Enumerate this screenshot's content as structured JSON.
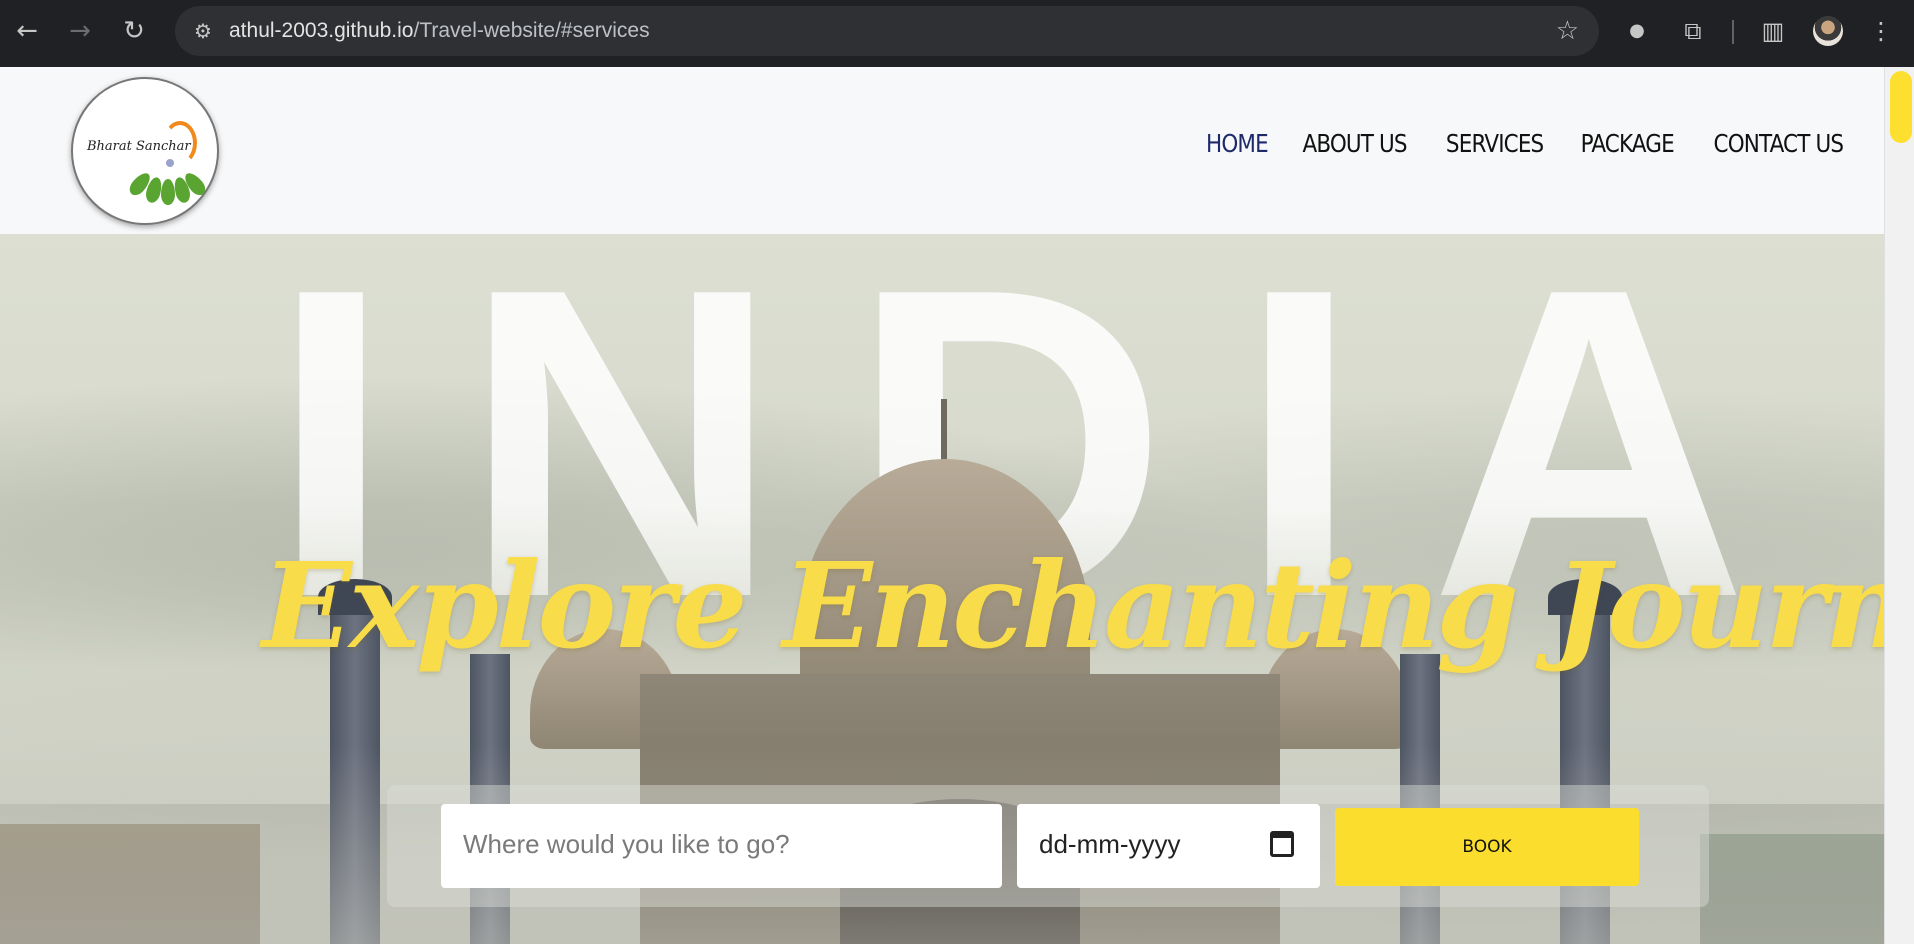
{
  "browser": {
    "url_host": "athul-2003.github.io",
    "url_path": "/Travel-website/#services",
    "icons": {
      "back": "back-arrow-icon",
      "forward": "forward-arrow-icon",
      "reload": "reload-icon",
      "site_info": "site-settings-icon",
      "bookmark": "star-icon",
      "extensions": "puzzle-icon",
      "side_panel": "side-panel-icon",
      "menu": "kebab-menu-icon"
    }
  },
  "header": {
    "logo_text": "Bharat Sanchar",
    "nav": [
      {
        "label": "HOME",
        "active": true
      },
      {
        "label": "ABOUT US",
        "active": false
      },
      {
        "label": "SERVICES",
        "active": false
      },
      {
        "label": "PACKAGE",
        "active": false
      },
      {
        "label": "CONTACT US",
        "active": false
      }
    ]
  },
  "hero": {
    "background_word": "INDIA",
    "headline": "Explore Enchanting Journeys!",
    "destination_placeholder": "Where would you like to go?",
    "date_placeholder": "dd-mm-yyyy",
    "book_label": "BOOK"
  },
  "colors": {
    "accent_yellow": "#fbdd2e",
    "headline_yellow": "#f9dc4a",
    "nav_active": "#1f2a6b"
  }
}
